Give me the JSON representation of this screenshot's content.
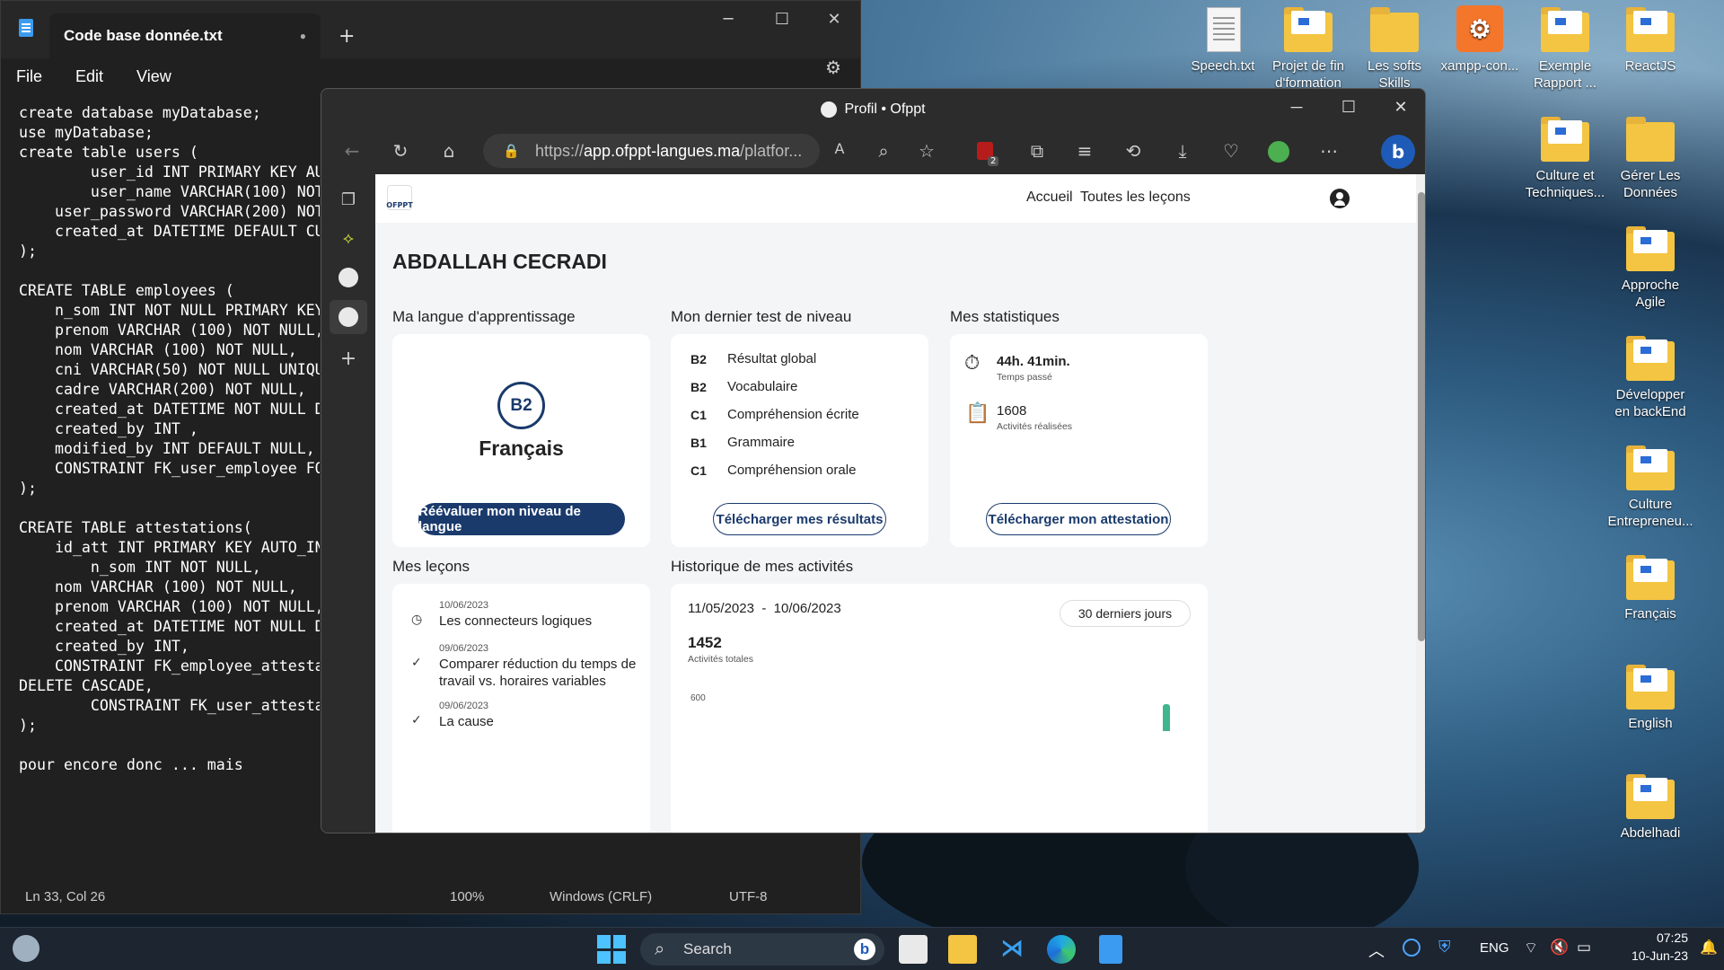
{
  "desktop_icons": [
    {
      "label": "Speech.txt",
      "type": "txt"
    },
    {
      "label": "Projet de fin d'formation",
      "type": "folder"
    },
    {
      "label": "Les softs Skills",
      "type": "folder-plain"
    },
    {
      "label": "xampp-con...",
      "type": "xampp"
    },
    {
      "label": "Exemple Rapport ...",
      "type": "folder"
    },
    {
      "label": "ReactJS",
      "type": "folder"
    },
    {
      "label": "Culture et Techniques...",
      "type": "folder"
    },
    {
      "label": "Gérer Les Données",
      "type": "folder-plain"
    },
    {
      "label": "Approche Agile",
      "type": "folder"
    },
    {
      "label": "Développer en backEnd",
      "type": "folder"
    },
    {
      "label": "Culture Entrepreneu...",
      "type": "folder"
    },
    {
      "label": "Français",
      "type": "folder"
    },
    {
      "label": "English",
      "type": "folder"
    },
    {
      "label": "Abdelhadi",
      "type": "folder"
    }
  ],
  "notepad": {
    "tab_title": "Code base donnée.txt",
    "tab_dot": "●",
    "new_tab": "+",
    "menu": [
      "File",
      "Edit",
      "View"
    ],
    "content": "create database myDatabase;\nuse myDatabase;\ncreate table users (\n        user_id INT PRIMARY KEY AUTO_INCREMENT,\n        user_name VARCHAR(100) NOT NULL,\n    user_password VARCHAR(200) NOT NULL,\n    created_at DATETIME DEFAULT CURRENT_TIMESTAMP\n);\n\nCREATE TABLE employees (\n    n_som INT NOT NULL PRIMARY KEY,\n    prenom VARCHAR (100) NOT NULL,\n    nom VARCHAR (100) NOT NULL,\n    cni VARCHAR(50) NOT NULL UNIQUE,\n    cadre VARCHAR(200) NOT NULL,\n    created_at DATETIME NOT NULL DEFAULT,\n    created_by INT ,\n    modified_by INT DEFAULT NULL,\n    CONSTRAINT FK_user_employee FOREIGN KEY\n);\n\nCREATE TABLE attestations(\n    id_att INT PRIMARY KEY AUTO_INCREMENT,\n        n_som INT NOT NULL,\n    nom VARCHAR (100) NOT NULL,\n    prenom VARCHAR (100) NOT NULL,\n    created_at DATETIME NOT NULL DEFAULT,\n    created_by INT,\n    CONSTRAINT FK_employee_attestation\nDELETE CASCADE,\n        CONSTRAINT FK_user_attestation\n);\n\npour encore donc ... mais",
    "status": {
      "position": "Ln 33, Col 26",
      "zoom": "100%",
      "eol": "Windows (CRLF)",
      "encoding": "UTF-8"
    }
  },
  "browser": {
    "title": "Profil • Ofppt",
    "url_prefix": "https://",
    "url_domain": "app.ofppt-langues.ma",
    "url_rest": "/platfor...",
    "ext_badge": "2",
    "page": {
      "logo_text": "OFPPT",
      "nav": [
        "Accueil",
        "Toutes les leçons"
      ],
      "user_name": "ABDALLAH CECRADI",
      "lang_section": "Ma langue d'apprentissage",
      "lang_level": "B2",
      "lang_name": "Français",
      "lang_button": "Réévaluer mon niveau de langue",
      "test_section": "Mon dernier test de niveau",
      "test_rows": [
        {
          "level": "B2",
          "label": "Résultat global"
        },
        {
          "level": "B2",
          "label": "Vocabulaire"
        },
        {
          "level": "C1",
          "label": "Compréhension écrite"
        },
        {
          "level": "B1",
          "label": "Grammaire"
        },
        {
          "level": "C1",
          "label": "Compréhension orale"
        }
      ],
      "test_button": "Télécharger mes résultats",
      "stats_section": "Mes statistiques",
      "stats": [
        {
          "value": "44h. 41min.",
          "label": "Temps passé"
        },
        {
          "value": "1608",
          "label": "Activités réalisées"
        }
      ],
      "stats_button": "Télécharger mon attestation",
      "lessons_section": "Mes leçons",
      "lessons": [
        {
          "date": "10/06/2023",
          "title": "Les connecteurs logiques",
          "status": "in-progress"
        },
        {
          "date": "09/06/2023",
          "title": "Comparer réduction du temps de travail vs. horaires variables",
          "status": "done"
        },
        {
          "date": "09/06/2023",
          "title": "La cause",
          "status": "done"
        }
      ],
      "history_section": "Historique de mes activités",
      "history_range_start": "11/05/2023",
      "history_range_sep": "-",
      "history_range_end": "10/06/2023",
      "history_filter": "30 derniers jours",
      "history_total": "1452",
      "history_total_label": "Activités totales",
      "history_axis_tick": "600"
    }
  },
  "taskbar": {
    "search": "Search",
    "lang": "ENG",
    "time": "07:25",
    "date": "10-Jun-23"
  },
  "colors": {
    "brand": "#1a3a6c",
    "accent_green": "#3fb68b"
  }
}
